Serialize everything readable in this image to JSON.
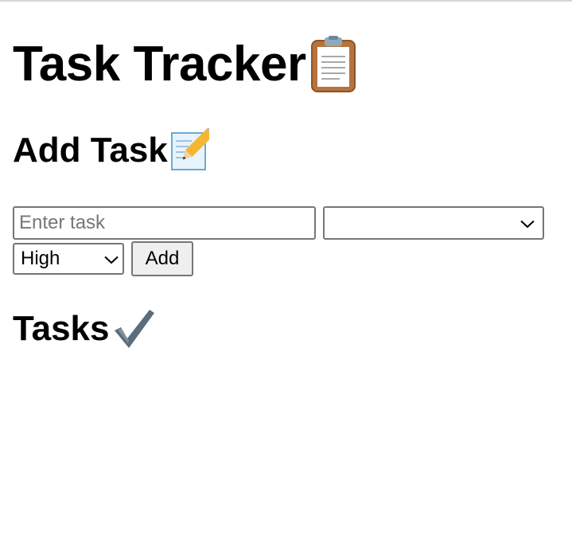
{
  "header": {
    "title": "Task Tracker",
    "title_icon": "clipboard-icon"
  },
  "add_section": {
    "heading": "Add Task",
    "heading_icon": "memo-pencil-icon",
    "task_input": {
      "value": "",
      "placeholder": "Enter task"
    },
    "category_select": {
      "selected": ""
    },
    "priority_select": {
      "selected": "High"
    },
    "add_button_label": "Add"
  },
  "tasks_section": {
    "heading": "Tasks",
    "heading_icon": "check-mark-icon",
    "items": []
  },
  "colors": {
    "border": "#767676",
    "button_bg": "#efefef",
    "placeholder": "#767676"
  }
}
